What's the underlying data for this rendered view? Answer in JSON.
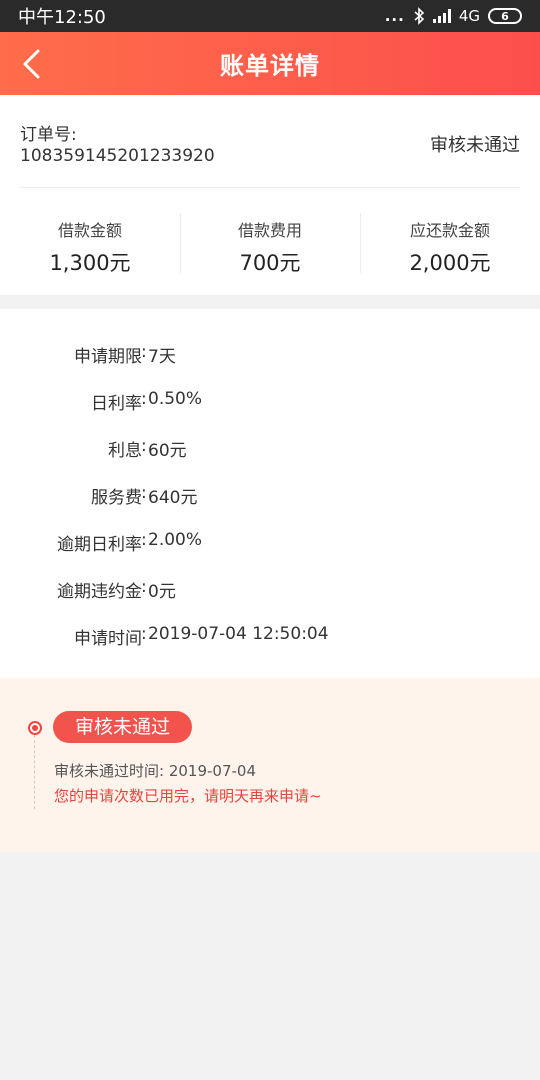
{
  "status_bar": {
    "time": "中午12:50",
    "dots": "...",
    "network": "4G",
    "battery": "6"
  },
  "header": {
    "title": "账单详情"
  },
  "order": {
    "label": "订单号:",
    "number": "108359145201233920",
    "status": "审核未通过"
  },
  "amounts": [
    {
      "label": "借款金额",
      "value": "1,300元"
    },
    {
      "label": "借款费用",
      "value": "700元"
    },
    {
      "label": "应还款金额",
      "value": "2,000元"
    }
  ],
  "details": [
    {
      "label": "申请期限",
      "value": "7天"
    },
    {
      "label": "日利率",
      "value": "0.50%"
    },
    {
      "label": "利息",
      "value": "60元"
    },
    {
      "label": "服务费",
      "value": "640元"
    },
    {
      "label": "逾期日利率",
      "value": "2.00%"
    },
    {
      "label": "逾期违约金",
      "value": "0元"
    },
    {
      "label": "申请时间",
      "value": "2019-07-04 12:50:04"
    }
  ],
  "detail_separator": ":",
  "timeline": {
    "badge": "审核未通过",
    "time_text": "审核未通过时间: 2019-07-04",
    "message": "您的申请次数已用完，请明天再来申请~"
  },
  "colors": {
    "accent": "#fc4f4c",
    "header_start": "#ff6d4a",
    "timeline_bg": "#fff4ec",
    "warning_text": "#e9433e"
  }
}
